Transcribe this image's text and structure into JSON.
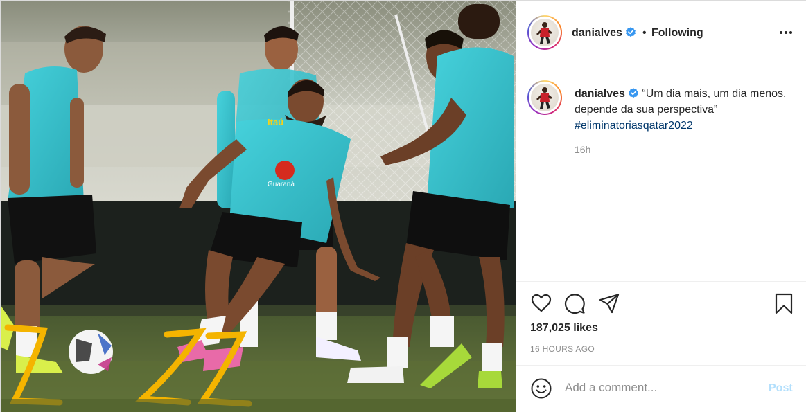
{
  "header": {
    "username": "danialves",
    "separator": "•",
    "follow_status": "Following",
    "more_icon": "more-options-icon"
  },
  "caption": {
    "username": "danialves",
    "text": "“Um dia mais, um dia menos, depende da sua perspectiva”",
    "hashtag": "#eliminatoriasqatar2022",
    "time_ago": "16h"
  },
  "actions": {
    "like_icon": "heart-icon",
    "comment_icon": "comment-icon",
    "share_icon": "share-icon",
    "save_icon": "bookmark-icon"
  },
  "likes": {
    "count_text": "187,025 likes"
  },
  "timestamp": "16 HOURS AGO",
  "comment_box": {
    "emoji_icon": "emoji-icon",
    "placeholder": "Add a comment...",
    "post_label": "Post"
  },
  "photo": {
    "jersey_sponsor": "Itaú",
    "jersey_brand": "Guaraná"
  },
  "colors": {
    "text": "#262626",
    "muted": "#8e8e8e",
    "hashtag": "#00376b",
    "verified": "#3897f0",
    "post_button_disabled": "#b2dffc",
    "jersey": "#3ec8d2",
    "hurdle": "#f4b400"
  }
}
